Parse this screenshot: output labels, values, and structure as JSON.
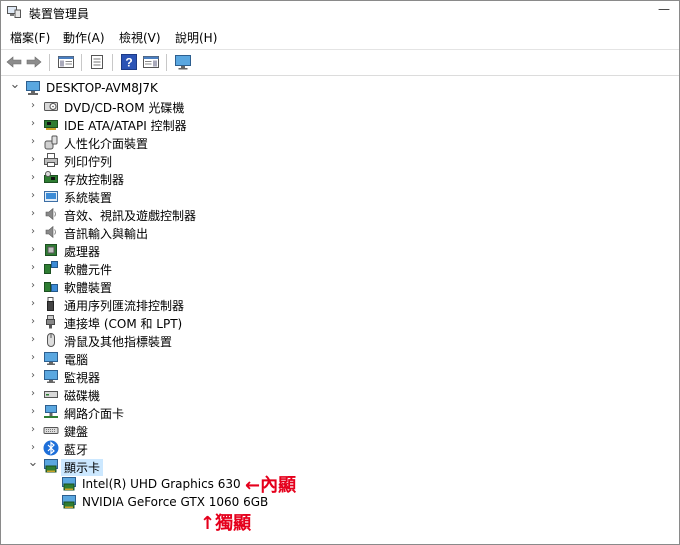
{
  "window": {
    "title": "裝置管理員",
    "minimize_glyph": "—"
  },
  "menu": [
    "檔案(F)",
    "動作(A)",
    "檢視(V)",
    "說明(H)"
  ],
  "toolbar": {
    "buttons": [
      "back-arrow-icon",
      "forward-arrow-icon",
      "console-tree-icon",
      "properties-icon",
      "help-icon",
      "action-pane-icon",
      "monitor-icon"
    ]
  },
  "tree": {
    "root": "DESKTOP-AVM8J7K",
    "categories": [
      {
        "label": "DVD/CD-ROM 光碟機",
        "icon": "disc-drive-icon"
      },
      {
        "label": "IDE ATA/ATAPI 控制器",
        "icon": "ide-controller-icon"
      },
      {
        "label": "人性化介面裝置",
        "icon": "hid-icon"
      },
      {
        "label": "列印佇列",
        "icon": "printer-icon"
      },
      {
        "label": "存放控制器",
        "icon": "storage-controller-icon"
      },
      {
        "label": "系統裝置",
        "icon": "system-device-icon"
      },
      {
        "label": "音效、視訊及遊戲控制器",
        "icon": "speaker-icon"
      },
      {
        "label": "音訊輸入與輸出",
        "icon": "audio-io-icon"
      },
      {
        "label": "處理器",
        "icon": "processor-icon"
      },
      {
        "label": "軟體元件",
        "icon": "software-component-icon"
      },
      {
        "label": "軟體裝置",
        "icon": "software-device-icon"
      },
      {
        "label": "通用序列匯流排控制器",
        "icon": "usb-icon"
      },
      {
        "label": "連接埠 (COM 和 LPT)",
        "icon": "port-icon"
      },
      {
        "label": "滑鼠及其他指標裝置",
        "icon": "mouse-icon"
      },
      {
        "label": "電腦",
        "icon": "computer-icon"
      },
      {
        "label": "監視器",
        "icon": "monitor-icon"
      },
      {
        "label": "磁碟機",
        "icon": "disk-drive-icon"
      },
      {
        "label": "網路介面卡",
        "icon": "network-adapter-icon"
      },
      {
        "label": "鍵盤",
        "icon": "keyboard-icon"
      },
      {
        "label": "藍牙",
        "icon": "bluetooth-icon"
      },
      {
        "label": "顯示卡",
        "icon": "display-adapter-icon",
        "expanded": true,
        "selected": true
      }
    ],
    "display_adapters": [
      {
        "label": "Intel(R) UHD Graphics 630",
        "icon": "display-adapter-icon"
      },
      {
        "label": "NVIDIA GeForce GTX 1060 6GB",
        "icon": "display-adapter-icon"
      }
    ]
  },
  "annotations": {
    "integrated": "←內顯",
    "discrete": "↑獨顯",
    "color": "#e5001c"
  }
}
